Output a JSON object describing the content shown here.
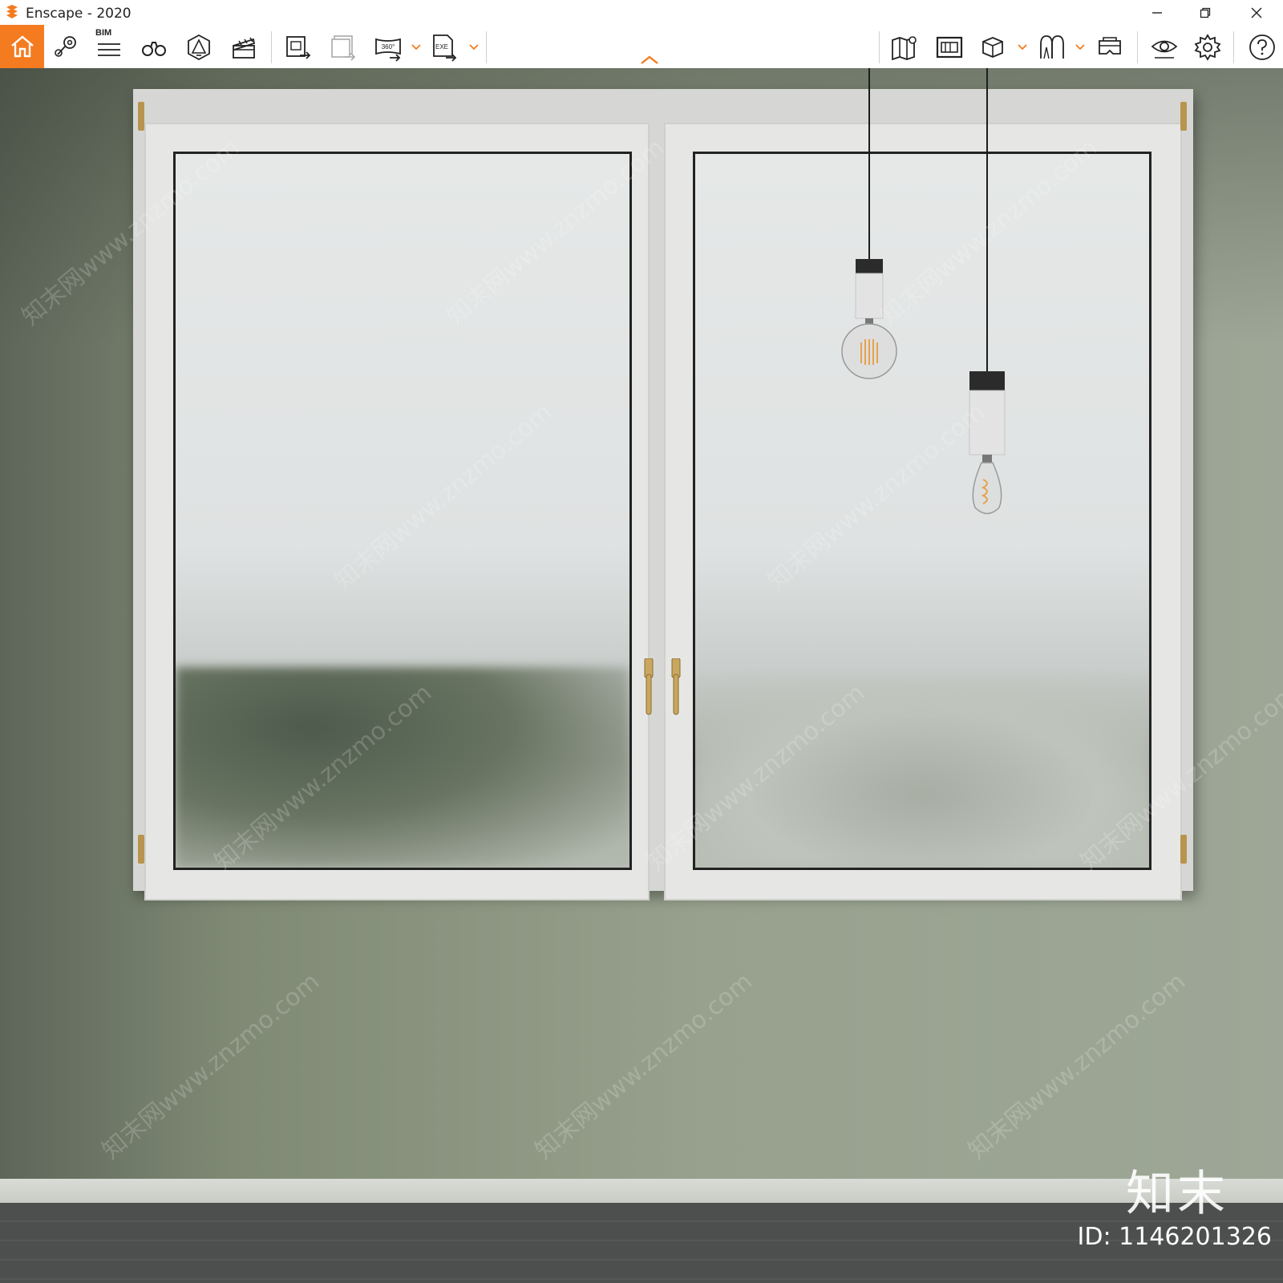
{
  "titlebar": {
    "app_title": "Enscape - 2020",
    "icons": [
      "enscape-logo-icon",
      "minimize-icon",
      "restore-icon",
      "close-icon"
    ]
  },
  "toolbar": {
    "accent_color": "#f47b20",
    "left_group": [
      {
        "name": "home",
        "icon": "home-icon",
        "active": true
      },
      {
        "name": "views",
        "icon": "location-pin-icon"
      },
      {
        "name": "bim",
        "icon": "bim-list-icon",
        "label": "BIM"
      },
      {
        "name": "binoculars",
        "icon": "binoculars-icon"
      },
      {
        "name": "light-view",
        "icon": "light-view-icon"
      },
      {
        "name": "video-editor",
        "icon": "clapperboard-icon"
      },
      {
        "name": "export-screenshot",
        "icon": "export-image-icon"
      },
      {
        "name": "batch-render",
        "icon": "batch-render-icon"
      },
      {
        "name": "export-panorama",
        "icon": "panorama-360-icon",
        "label": "360°"
      },
      {
        "name": "export-exe",
        "icon": "export-exe-icon",
        "label": "EXE"
      }
    ],
    "right_group": [
      {
        "name": "map",
        "icon": "map-pin-icon"
      },
      {
        "name": "asset-library",
        "icon": "asset-library-icon"
      },
      {
        "name": "cube-view",
        "icon": "cube-icon"
      },
      {
        "name": "walk-mode",
        "icon": "walk-icon"
      },
      {
        "name": "vr-headset",
        "icon": "vr-headset-icon"
      },
      {
        "name": "visual-settings",
        "icon": "eye-icon"
      },
      {
        "name": "general-settings",
        "icon": "gear-icon"
      },
      {
        "name": "help",
        "icon": "help-icon"
      }
    ]
  },
  "scene": {
    "wall_color": "#8f9a88",
    "floor_color": "#4f5151",
    "window_frame_color": "#e6e7e5"
  },
  "watermark": {
    "text": "知末网www.znzmo.com",
    "brand": "知末",
    "image_id": "ID: 1146201326"
  }
}
